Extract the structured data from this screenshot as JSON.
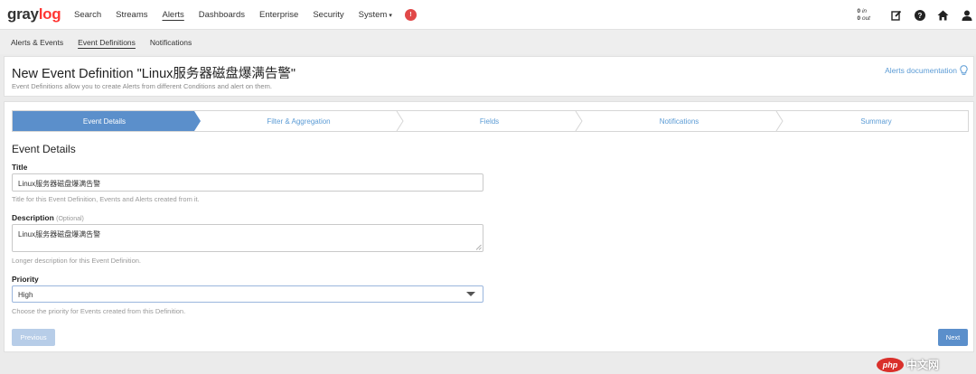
{
  "brand": {
    "text_main": "gray",
    "text_accent": "log"
  },
  "nav": {
    "items": [
      {
        "label": "Search"
      },
      {
        "label": "Streams"
      },
      {
        "label": "Alerts"
      },
      {
        "label": "Dashboards"
      },
      {
        "label": "Enterprise"
      },
      {
        "label": "Security"
      },
      {
        "label": "System",
        "caret": "▾"
      }
    ],
    "notification_badge": "!",
    "throughput": {
      "in_value": "0",
      "in_unit": "in",
      "out_value": "0",
      "out_unit": "out"
    }
  },
  "subnav": {
    "items": [
      {
        "label": "Alerts & Events"
      },
      {
        "label": "Event Definitions"
      },
      {
        "label": "Notifications"
      }
    ]
  },
  "header": {
    "title": "New Event Definition \"Linux服务器磁盘爆满告警\"",
    "description": "Event Definitions allow you to create Alerts from different Conditions and alert on them.",
    "docs_link": "Alerts documentation"
  },
  "wizard": {
    "steps": [
      {
        "label": "Event Details"
      },
      {
        "label": "Filter & Aggregation"
      },
      {
        "label": "Fields"
      },
      {
        "label": "Notifications"
      },
      {
        "label": "Summary"
      }
    ]
  },
  "form": {
    "section_title": "Event Details",
    "title_label": "Title",
    "title_value": "Linux服务器磁盘爆满告警",
    "title_help": "Title for this Event Definition, Events and Alerts created from it.",
    "description_label": "Description",
    "description_optional": "(Optional)",
    "description_value": "Linux服务器磁盘爆满告警",
    "description_help": "Longer description for this Event Definition.",
    "priority_label": "Priority",
    "priority_value": "High",
    "priority_help": "Choose the priority for Events created from this Definition."
  },
  "buttons": {
    "previous": "Previous",
    "next": "Next"
  },
  "watermark": {
    "logo": "php",
    "text": "中文网"
  },
  "colors": {
    "accent": "#5b8fcb",
    "active_step": "#5b8fcb",
    "brand_red": "#ff3633",
    "badge": "#e14848"
  }
}
